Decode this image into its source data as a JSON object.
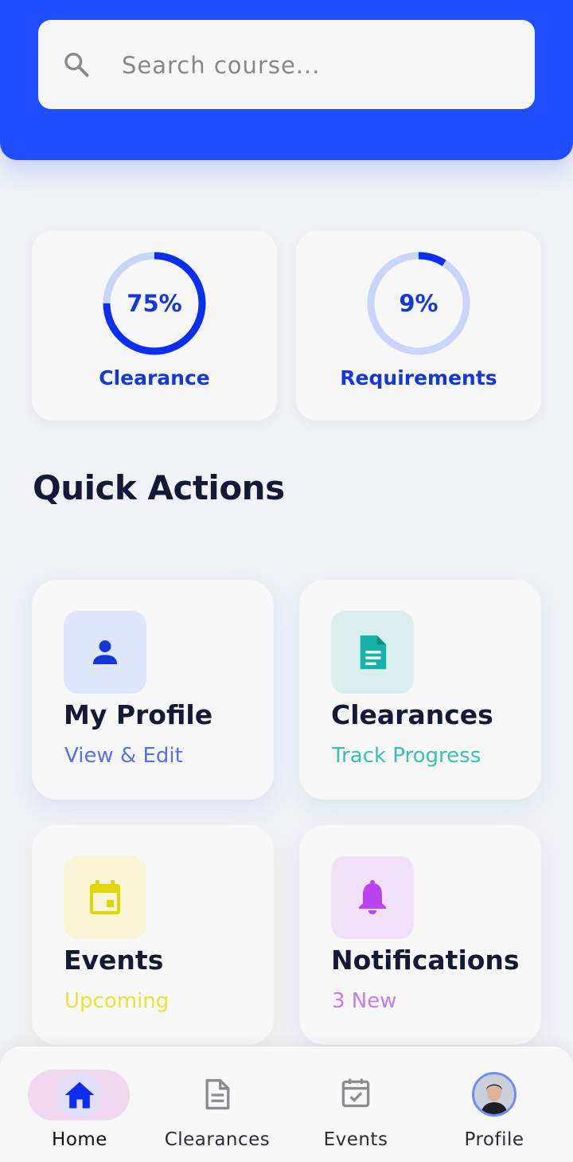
{
  "colors": {
    "header": "#1f4dff",
    "accent": "#1437d6",
    "ring_track": "#c9d5fb",
    "profile": "#5572e8",
    "clearances": "#3bbeb3",
    "events": "#ebe33a",
    "notifications": "#c77be8"
  },
  "search": {
    "placeholder": "Search course..."
  },
  "stats": [
    {
      "value_text": "75%",
      "percent": 75,
      "label": "Clearance"
    },
    {
      "value_text": "9%",
      "percent": 9,
      "label": "Requirements"
    }
  ],
  "quick_actions": {
    "title": "Quick Actions",
    "items": [
      {
        "title": "My Profile",
        "subtitle": "View & Edit",
        "icon": "person-icon"
      },
      {
        "title": "Clearances",
        "subtitle": "Track Progress",
        "icon": "document-icon"
      },
      {
        "title": "Events",
        "subtitle": "Upcoming",
        "icon": "calendar-icon"
      },
      {
        "title": "Notifications",
        "subtitle": "3 New",
        "icon": "bell-icon"
      }
    ]
  },
  "nav": {
    "items": [
      {
        "label": "Home",
        "icon": "home-icon",
        "active": true
      },
      {
        "label": "Clearances",
        "icon": "document-outline-icon",
        "active": false
      },
      {
        "label": "Events",
        "icon": "calendar-check-icon",
        "active": false
      },
      {
        "label": "Profile",
        "icon": "avatar",
        "active": false
      }
    ]
  }
}
